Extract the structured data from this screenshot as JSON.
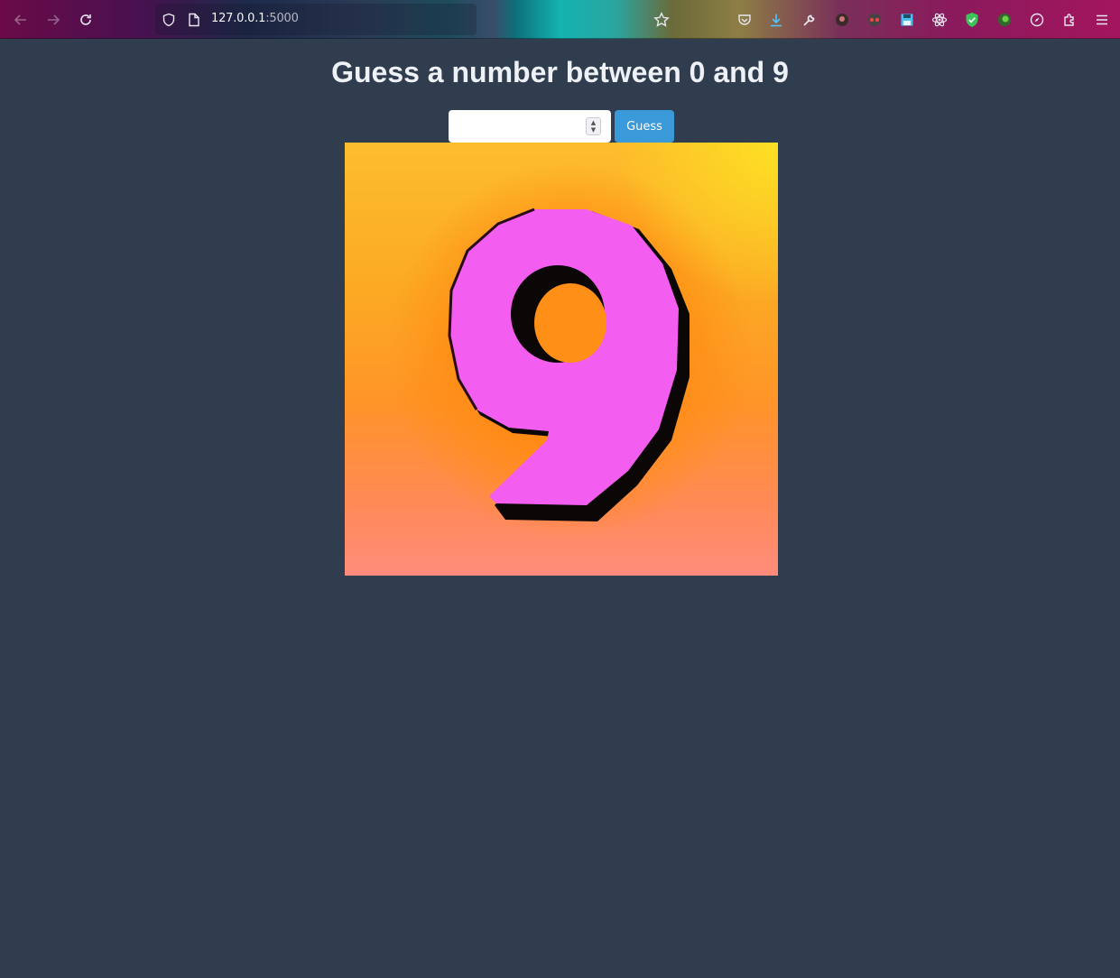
{
  "browser": {
    "url_host": "127.0.0.1",
    "url_port": ":5000",
    "icons": {
      "back": "arrow-left-icon",
      "forward": "arrow-right-icon",
      "reload": "reload-icon",
      "shield": "shield-icon",
      "page": "page-icon",
      "bookmark": "star-icon",
      "pocket": "pocket-icon",
      "downloads": "download-icon",
      "tools": "wrench-icon",
      "menu": "hamburger-menu-icon"
    }
  },
  "page": {
    "title": "Guess a number between 0 and 9",
    "input": {
      "value": "",
      "placeholder": ""
    },
    "button_label": "Guess",
    "image": {
      "depicts": "9"
    }
  },
  "colors": {
    "page_background": "#2f3d4f",
    "button": "#3a9ad9",
    "digit_fill": "#f55ef0"
  }
}
